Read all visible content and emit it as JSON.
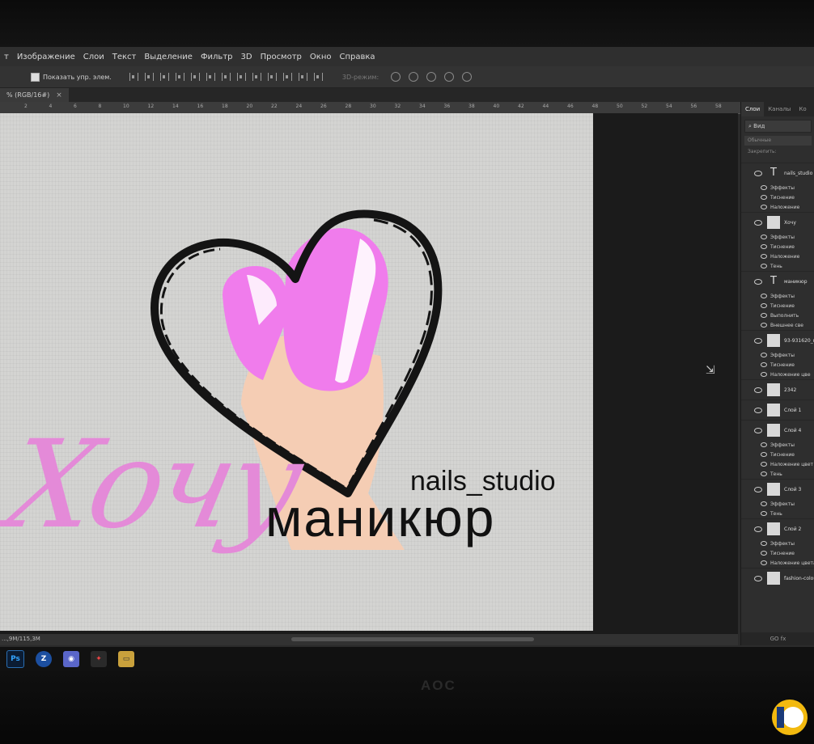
{
  "menubar": {
    "items": [
      {
        "label": "т"
      },
      {
        "label": "Изображение"
      },
      {
        "label": "Слои"
      },
      {
        "label": "Текст"
      },
      {
        "label": "Выделение"
      },
      {
        "label": "Фильтр"
      },
      {
        "label": "3D"
      },
      {
        "label": "Просмотр"
      },
      {
        "label": "Окно"
      },
      {
        "label": "Справка"
      }
    ]
  },
  "options": {
    "show_controls_label": "Показать упр. элем.",
    "mode_3d_label": "3D-режим:"
  },
  "document": {
    "tab_title": "% (RGB/16#)",
    "close_glyph": "×"
  },
  "ruler": {
    "ticks": [
      "2",
      "4",
      "6",
      "8",
      "10",
      "12",
      "14",
      "16",
      "18",
      "20",
      "22",
      "24",
      "26",
      "28",
      "30",
      "32",
      "34",
      "36",
      "38",
      "40",
      "42",
      "44",
      "46",
      "48",
      "50",
      "52",
      "54",
      "56",
      "58",
      "60",
      "62",
      "64"
    ]
  },
  "artwork": {
    "word_hochu": "Хочу",
    "word_studio": "nails_studio",
    "word_manicure": "маникюр",
    "colors": {
      "pink": "#e48ad8",
      "nail_pink": "#f07cec",
      "skin": "#f5cdb4",
      "outline": "#141414"
    }
  },
  "status": {
    "doc_size": "...,9М/115,3М"
  },
  "layers_panel": {
    "tabs": [
      "Слои",
      "Каналы",
      "Ко"
    ],
    "search_label": "Вид",
    "blend_mode": "Обычные",
    "lock_label": "Закрепить:",
    "bottom_label": "GO  fx",
    "rows": [
      {
        "kind": "main",
        "name": "nails_studio",
        "type": "text"
      },
      {
        "kind": "fx",
        "name": "Эффекты"
      },
      {
        "kind": "fx",
        "name": "Тиснение"
      },
      {
        "kind": "fx",
        "name": "Наложение"
      },
      {
        "kind": "main",
        "name": "Хочу",
        "type": "image"
      },
      {
        "kind": "fx",
        "name": "Эффекты"
      },
      {
        "kind": "fx",
        "name": "Тиснение"
      },
      {
        "kind": "fx",
        "name": "Наложение"
      },
      {
        "kind": "fx",
        "name": "Тень"
      },
      {
        "kind": "main",
        "name": "маникюр",
        "type": "text"
      },
      {
        "kind": "fx",
        "name": "Эффекты"
      },
      {
        "kind": "fx",
        "name": "Тиснение"
      },
      {
        "kind": "fx",
        "name": "Выполнить"
      },
      {
        "kind": "fx",
        "name": "Внешнее све"
      },
      {
        "kind": "main",
        "name": "93-931620_nhu",
        "type": "image"
      },
      {
        "kind": "fx",
        "name": "Эффекты"
      },
      {
        "kind": "fx",
        "name": "Тиснение"
      },
      {
        "kind": "fx",
        "name": "Наложение цве"
      },
      {
        "kind": "main",
        "name": "2342",
        "type": "image"
      },
      {
        "kind": "main",
        "name": "Слой 1",
        "type": "image"
      },
      {
        "kind": "main",
        "name": "Слой 4",
        "type": "image"
      },
      {
        "kind": "fx",
        "name": "Эффекты"
      },
      {
        "kind": "fx",
        "name": "Тиснение"
      },
      {
        "kind": "fx",
        "name": "Наложение цвет"
      },
      {
        "kind": "fx",
        "name": "Тень"
      },
      {
        "kind": "main",
        "name": "Слой 3",
        "type": "image"
      },
      {
        "kind": "fx",
        "name": "Эффекты"
      },
      {
        "kind": "fx",
        "name": "Тень"
      },
      {
        "kind": "main",
        "name": "Слой 2",
        "type": "image"
      },
      {
        "kind": "fx",
        "name": "Эффекты"
      },
      {
        "kind": "fx",
        "name": "Тиснение"
      },
      {
        "kind": "fx",
        "name": "Наложение цвета"
      },
      {
        "kind": "main",
        "name": "fashion-colours-nail-vec",
        "type": "image"
      }
    ]
  },
  "taskbar": {
    "apps": [
      {
        "id": "photoshop",
        "glyph": "Ps"
      },
      {
        "id": "zona",
        "glyph": "Z"
      },
      {
        "id": "discord",
        "glyph": "◉"
      },
      {
        "id": "bird",
        "glyph": "✦"
      },
      {
        "id": "explorer",
        "glyph": "▭"
      }
    ]
  },
  "monitor": {
    "brand": "AOC"
  }
}
